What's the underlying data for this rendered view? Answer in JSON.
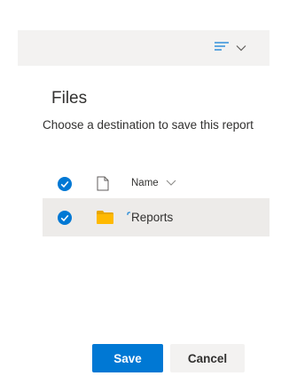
{
  "toolbar": {
    "view_icon": "list-view-icon",
    "chevron_icon": "chevron-down-icon",
    "accent_color": "#0078d4"
  },
  "title": "Files",
  "subtitle": "Choose a destination to save this report",
  "list": {
    "header": {
      "select_all_icon": "check-circle-icon",
      "file_type_icon": "document-icon",
      "name_label": "Name",
      "sort_icon": "chevron-down-icon"
    },
    "rows": [
      {
        "name": "Reports",
        "icon": "folder-icon",
        "selected": true,
        "loading_icon": "spinner-icon"
      }
    ]
  },
  "actions": {
    "save_label": "Save",
    "cancel_label": "Cancel"
  },
  "colors": {
    "primary": "#0078d4",
    "toolbar_bg": "#f3f2f1",
    "selected_row_bg": "#edebe9",
    "folder": "#ffb900"
  }
}
